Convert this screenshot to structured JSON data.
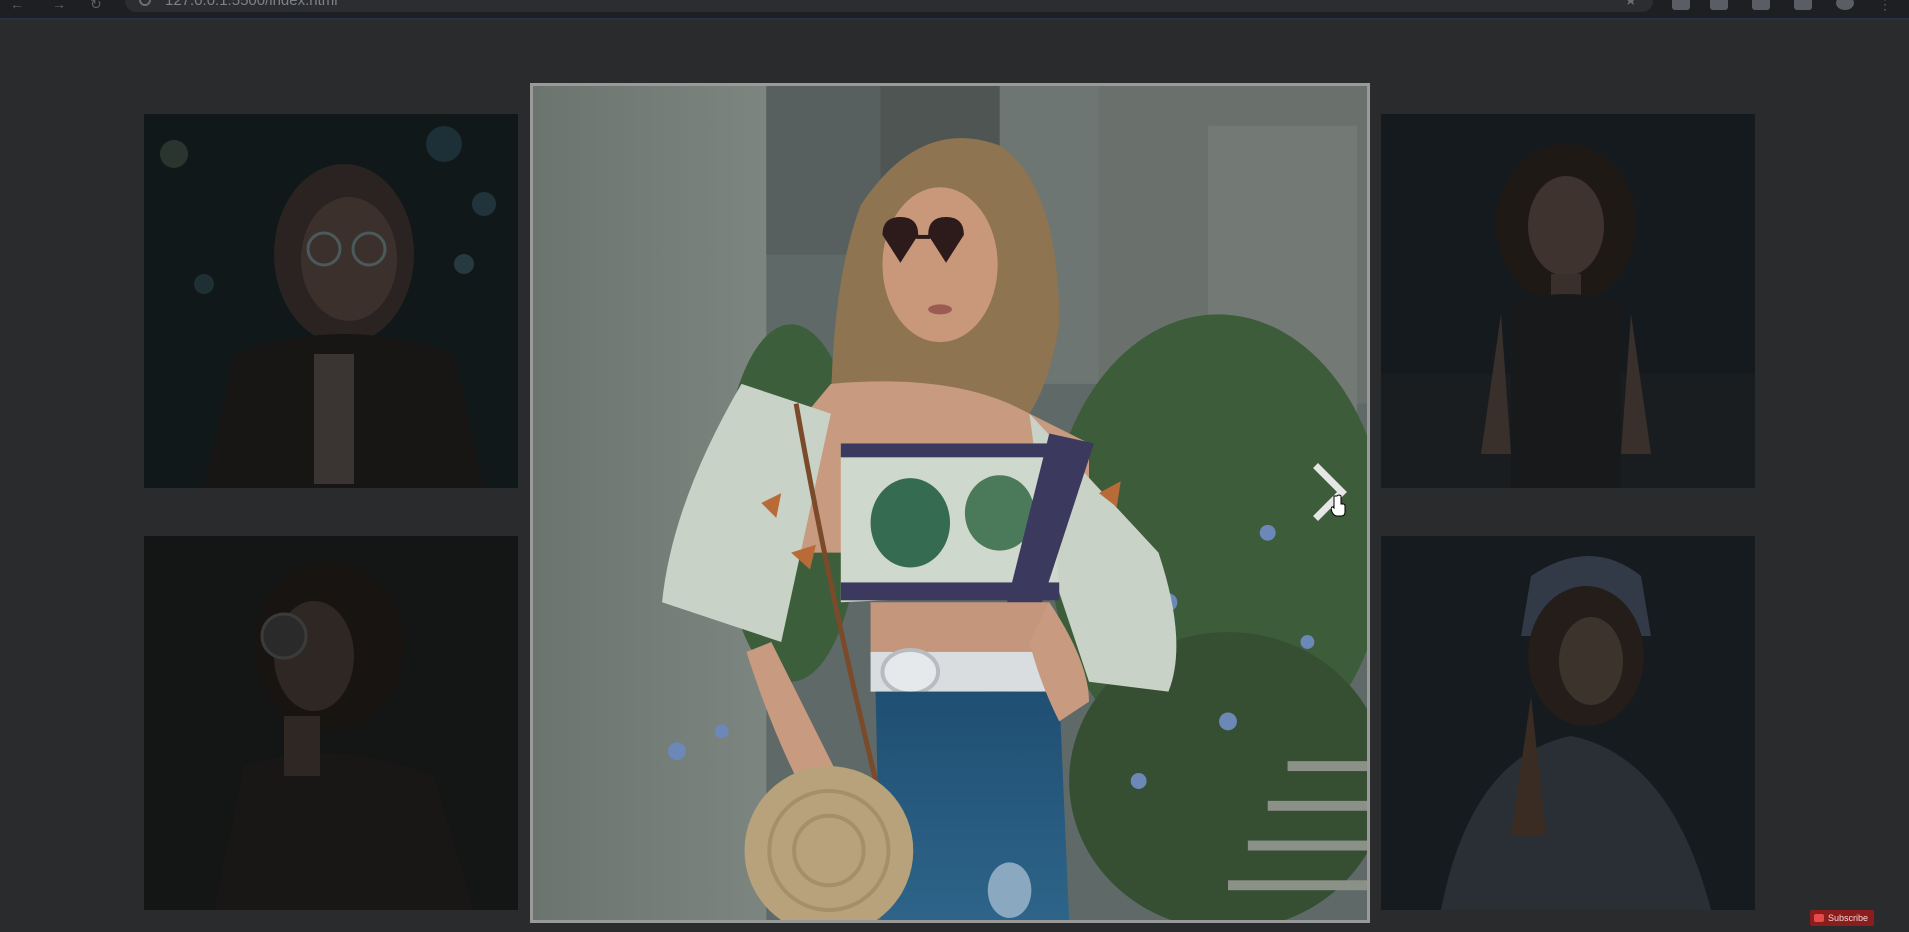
{
  "browser": {
    "url": "127.0.0.1:5500/index.html"
  },
  "gallery": {
    "thumbnails": [
      {
        "description": "woman-with-glasses-bokeh"
      },
      {
        "description": "woman-black-top-seated"
      },
      {
        "description": "woman-sunglasses-dark"
      },
      {
        "description": "woman-hood-sitting"
      }
    ]
  },
  "lightbox": {
    "image_alt": "woman-in-floral-top",
    "next_icon": "chevron-right-icon"
  },
  "youtube": {
    "subscribe_label": "Subscribe"
  },
  "colors": {
    "page_background": "#2a2b2d",
    "lightbox_border": "#9a9a9a"
  }
}
